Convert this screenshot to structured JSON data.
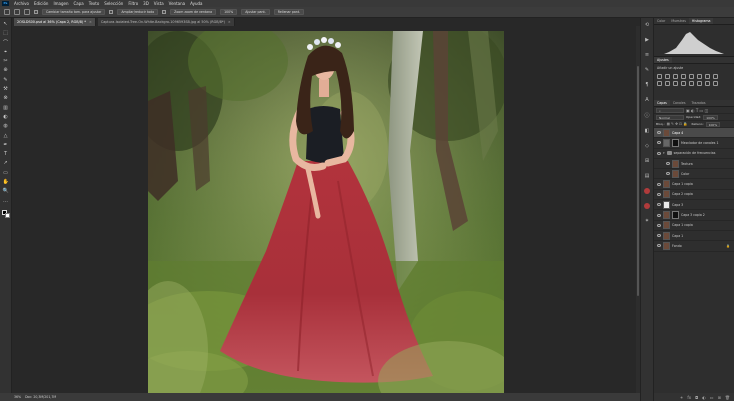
{
  "menu": [
    "Archivo",
    "Edición",
    "Imagen",
    "Capa",
    "Texto",
    "Selección",
    "Filtro",
    "3D",
    "Vista",
    "Ventana",
    "Ayuda"
  ],
  "app_badge": "Ps",
  "options_bar": {
    "sample_all_layers": "Cambiar tamaño tam. para ajustar",
    "scrubby_zoom": "Zoom zoom de ventana",
    "resize_windows": "Ampliar/reducir todo",
    "zoom_level": "100%",
    "fit_screen": "Ajustar pant.",
    "fill_screen": "Rellenar pant."
  },
  "doc_tabs": [
    {
      "label": "2OSLDS00.psd al 36% (Capa 2, RGB/8) *",
      "active": true
    },
    {
      "label": "Captura-Isolated-Tree-On-White-Backgro-1096593SB.jpg al 50% (RGB/8*)",
      "active": false
    }
  ],
  "tools": [
    "↖",
    "⬚",
    "⌒",
    "⌖",
    "✂",
    "⊕",
    "✎",
    "⚒",
    "⊗",
    "▥",
    "◐",
    "◍",
    "△",
    "✒",
    "T",
    "↗",
    "▭",
    "✋",
    "🔍",
    "…"
  ],
  "status": {
    "zoom": "36%",
    "doc_size": "Doc: 20,3M/201,7M"
  },
  "panels": {
    "top_tabs": [
      {
        "label": "Color",
        "active": false
      },
      {
        "label": "Muestras",
        "active": false
      },
      {
        "label": "Histograma",
        "active": true
      }
    ],
    "adjust_tabs": [
      {
        "label": "Ajustes",
        "active": true
      }
    ],
    "adjust_label": "Añadir un ajuste",
    "layer_tabs": [
      {
        "label": "Capas",
        "active": true
      },
      {
        "label": "Canales",
        "active": false
      },
      {
        "label": "Trazados",
        "active": false
      }
    ],
    "blend_mode": "Normal",
    "opacity_label": "Opacidad:",
    "opacity_value": "100%",
    "lock_label": "Bloq.:",
    "fill_label": "Relleno:",
    "fill_value": "100%",
    "layers": [
      {
        "name": "Capa 4",
        "thumb": "photo",
        "selected": true
      },
      {
        "name": "Mezclador de canales 1",
        "thumb": "adj",
        "mask": true
      },
      {
        "name": "separación de frecuencias",
        "thumb": "folder"
      },
      {
        "name": "Textura",
        "thumb": "photo"
      },
      {
        "name": "Color",
        "thumb": "photo"
      },
      {
        "name": "Capa 1 copia",
        "thumb": "photo"
      },
      {
        "name": "Capa 2 copia",
        "thumb": "photo"
      },
      {
        "name": "Capa 3",
        "thumb": "white"
      },
      {
        "name": "Capa 3 copia 2",
        "thumb": "photo",
        "mask": true
      },
      {
        "name": "Capa 1 copia",
        "thumb": "photo"
      },
      {
        "name": "Capa 1",
        "thumb": "photo"
      },
      {
        "name": "Fondo",
        "thumb": "photo"
      }
    ]
  },
  "colors": {
    "skirt": "#b2333c",
    "ui_bg": "#282828",
    "selection": "#4a4a4a"
  }
}
